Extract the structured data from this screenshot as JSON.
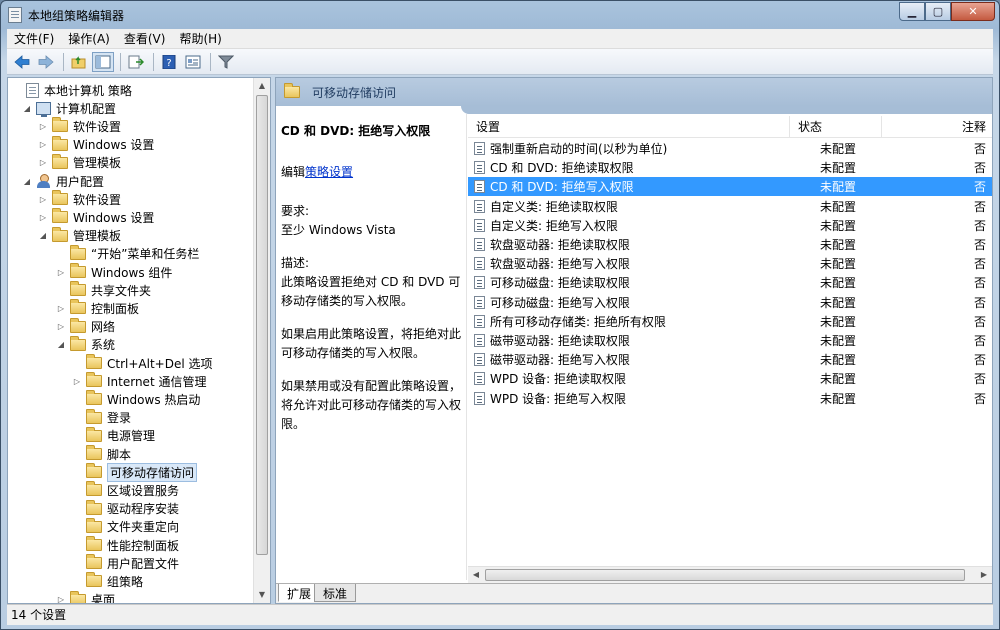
{
  "window": {
    "title": "本地组策略编辑器",
    "minimize": "▁",
    "maximize": "▢",
    "close": "✕"
  },
  "menu": [
    "文件(F)",
    "操作(A)",
    "查看(V)",
    "帮助(H)"
  ],
  "tree": {
    "items": [
      {
        "label": "本地计算机 策略",
        "icon": "document-icon",
        "expander": ""
      },
      {
        "label": "计算机配置",
        "icon": "computer-icon",
        "expander": "◢"
      },
      {
        "label": "软件设置",
        "icon": "folder-icon",
        "expander": "▷"
      },
      {
        "label": "Windows 设置",
        "icon": "folder-icon",
        "expander": "▷"
      },
      {
        "label": "管理模板",
        "icon": "folder-icon",
        "expander": "▷"
      },
      {
        "label": "用户配置",
        "icon": "user-icon",
        "expander": "◢"
      },
      {
        "label": "软件设置",
        "icon": "folder-icon",
        "expander": "▷"
      },
      {
        "label": "Windows 设置",
        "icon": "folder-icon",
        "expander": "▷"
      },
      {
        "label": "管理模板",
        "icon": "folder-icon",
        "expander": "◢"
      },
      {
        "label": "“开始”菜单和任务栏",
        "icon": "folder-icon",
        "expander": ""
      },
      {
        "label": "Windows 组件",
        "icon": "folder-icon",
        "expander": "▷"
      },
      {
        "label": "共享文件夹",
        "icon": "folder-icon",
        "expander": ""
      },
      {
        "label": "控制面板",
        "icon": "folder-icon",
        "expander": "▷"
      },
      {
        "label": "网络",
        "icon": "folder-icon",
        "expander": "▷"
      },
      {
        "label": "系统",
        "icon": "folder-icon",
        "expander": "◢"
      },
      {
        "label": "Ctrl+Alt+Del 选项",
        "icon": "folder-icon",
        "expander": ""
      },
      {
        "label": "Internet 通信管理",
        "icon": "folder-icon",
        "expander": "▷"
      },
      {
        "label": "Windows 热启动",
        "icon": "folder-icon",
        "expander": ""
      },
      {
        "label": "登录",
        "icon": "folder-icon",
        "expander": ""
      },
      {
        "label": "电源管理",
        "icon": "folder-icon",
        "expander": ""
      },
      {
        "label": "脚本",
        "icon": "folder-icon",
        "expander": ""
      },
      {
        "label": "可移动存储访问",
        "icon": "folder-icon",
        "expander": ""
      },
      {
        "label": "区域设置服务",
        "icon": "folder-icon",
        "expander": ""
      },
      {
        "label": "驱动程序安装",
        "icon": "folder-icon",
        "expander": ""
      },
      {
        "label": "文件夹重定向",
        "icon": "folder-icon",
        "expander": ""
      },
      {
        "label": "性能控制面板",
        "icon": "folder-icon",
        "expander": ""
      },
      {
        "label": "用户配置文件",
        "icon": "folder-icon",
        "expander": ""
      },
      {
        "label": "组策略",
        "icon": "folder-icon",
        "expander": ""
      },
      {
        "label": "桌面",
        "icon": "folder-icon",
        "expander": "▷"
      }
    ]
  },
  "right": {
    "header_title": "可移动存储访问",
    "extended": {
      "title": "CD 和 DVD: 拒绝写入权限",
      "edit_prefix": "编辑",
      "edit_link": "策略设置",
      "req_label": "要求:",
      "req_value": "至少 Windows Vista",
      "desc_label": "描述:",
      "desc_1": "此策略设置拒绝对 CD 和 DVD 可移动存储类的写入权限。",
      "desc_2": "如果启用此策略设置，将拒绝对此可移动存储类的写入权限。",
      "desc_3": "如果禁用或没有配置此策略设置，将允许对此可移动存储类的写入权限。"
    },
    "columns": [
      "设置",
      "状态",
      "注释"
    ],
    "rows": [
      {
        "setting": "强制重新启动的时间(以秒为单位)",
        "state": "未配置",
        "comment": "否"
      },
      {
        "setting": "CD 和 DVD: 拒绝读取权限",
        "state": "未配置",
        "comment": "否"
      },
      {
        "setting": "CD 和 DVD: 拒绝写入权限",
        "state": "未配置",
        "comment": "否"
      },
      {
        "setting": "自定义类: 拒绝读取权限",
        "state": "未配置",
        "comment": "否"
      },
      {
        "setting": "自定义类: 拒绝写入权限",
        "state": "未配置",
        "comment": "否"
      },
      {
        "setting": "软盘驱动器: 拒绝读取权限",
        "state": "未配置",
        "comment": "否"
      },
      {
        "setting": "软盘驱动器: 拒绝写入权限",
        "state": "未配置",
        "comment": "否"
      },
      {
        "setting": "可移动磁盘: 拒绝读取权限",
        "state": "未配置",
        "comment": "否"
      },
      {
        "setting": "可移动磁盘: 拒绝写入权限",
        "state": "未配置",
        "comment": "否"
      },
      {
        "setting": "所有可移动存储类: 拒绝所有权限",
        "state": "未配置",
        "comment": "否"
      },
      {
        "setting": "磁带驱动器: 拒绝读取权限",
        "state": "未配置",
        "comment": "否"
      },
      {
        "setting": "磁带驱动器: 拒绝写入权限",
        "state": "未配置",
        "comment": "否"
      },
      {
        "setting": "WPD 设备: 拒绝读取权限",
        "state": "未配置",
        "comment": "否"
      },
      {
        "setting": "WPD 设备: 拒绝写入权限",
        "state": "未配置",
        "comment": "否"
      }
    ],
    "selected_row": 2,
    "tabs": [
      "扩展",
      "标准"
    ]
  },
  "status": {
    "text": "14 个设置"
  },
  "colors": {
    "selection": "#3399ff",
    "header_band": "#a6bdd6",
    "link": "#0033cc"
  }
}
